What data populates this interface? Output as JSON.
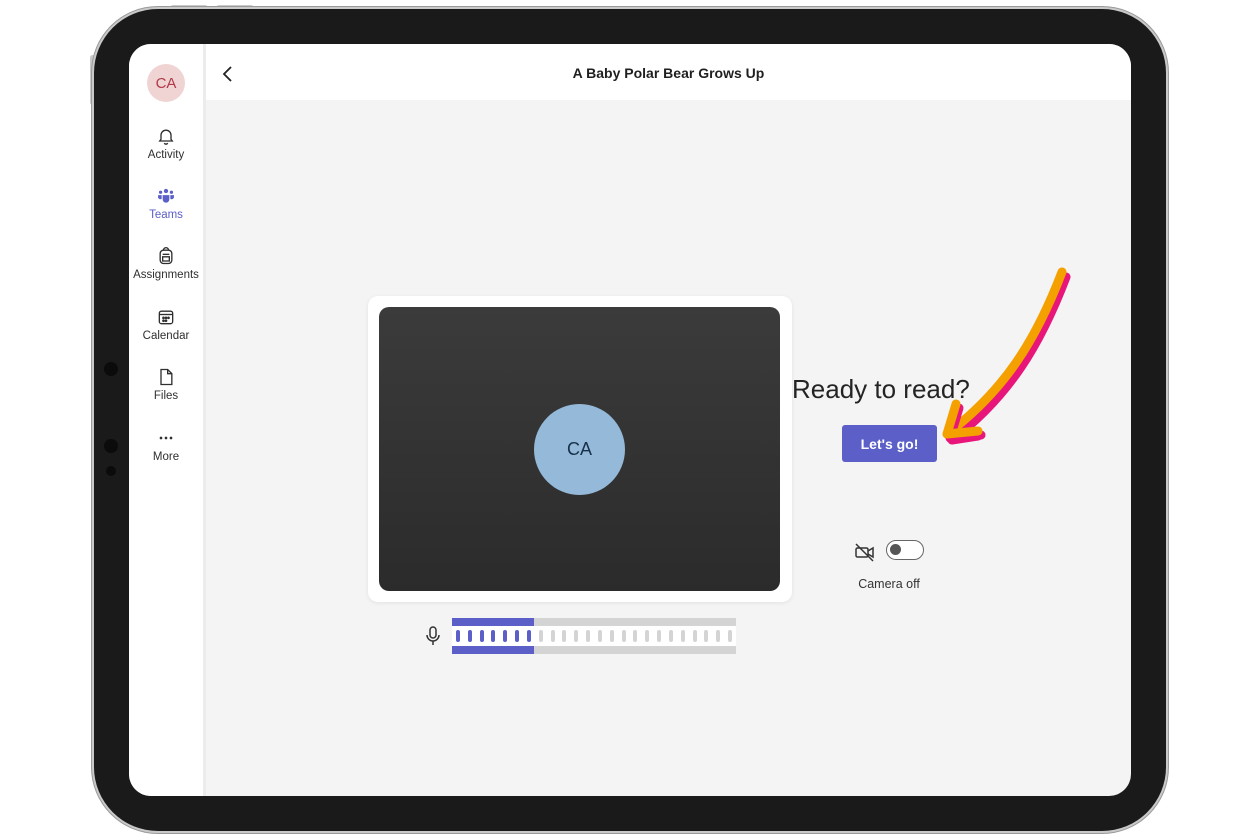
{
  "user": {
    "initials": "CA"
  },
  "sidebar": {
    "items": [
      {
        "label": "Activity",
        "icon": "bell-icon"
      },
      {
        "label": "Teams",
        "icon": "teams-icon",
        "active": true
      },
      {
        "label": "Assignments",
        "icon": "backpack-icon"
      },
      {
        "label": "Calendar",
        "icon": "calendar-icon"
      },
      {
        "label": "Files",
        "icon": "file-icon"
      },
      {
        "label": "More",
        "icon": "more-icon"
      }
    ]
  },
  "header": {
    "title": "A Baby Polar Bear Grows Up",
    "back_icon": "chevron-left-icon"
  },
  "prejoin": {
    "heading": "Ready to read?",
    "join_label": "Let's go!",
    "camera_label": "Camera off",
    "camera_on": false,
    "mic_level": 0.29
  },
  "colors": {
    "accent": "#5b5fc7",
    "avatar_bg": "#95b9d9",
    "annotation_arrow": "#f4a100",
    "annotation_shadow": "#e8157a"
  }
}
